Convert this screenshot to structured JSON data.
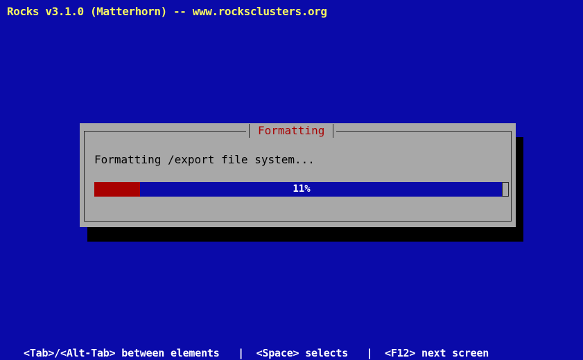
{
  "title_bar": {
    "text": "Rocks v3.1.0 (Matterhorn) -- www.rocksclusters.org"
  },
  "dialog": {
    "title": "Formatting",
    "status": "Formatting /export file system...",
    "progress": {
      "percent": 11,
      "label": "11%"
    }
  },
  "help_line": {
    "text": "<Tab>/<Alt-Tab> between elements   |  <Space> selects   |  <F12> next screen"
  },
  "colors": {
    "background": "#0A0AA9",
    "title_bar": "#F8F860",
    "dialog": "#A8A8A8",
    "dialog_title": "#A80000",
    "progress_fill": "#A80000",
    "progress_track": "#0A0AA9",
    "shadow": "#000000"
  }
}
